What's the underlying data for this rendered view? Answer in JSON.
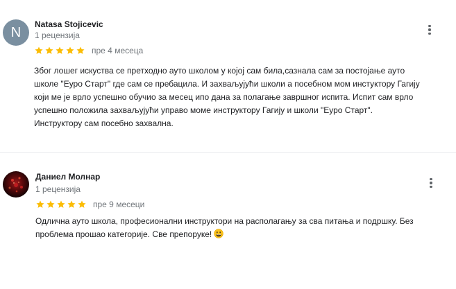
{
  "reviews": [
    {
      "avatar_letter": "N",
      "author": "Natasa Stojicevic",
      "review_count": "1 рецензија",
      "rating": 5,
      "time_ago": "пре 4 месеца",
      "text_lines": [
        "Због лошег искуства се претходно ауто школом у којој сам била,сазнала сам за постојање  ауто",
        "школе \"Еуро Старт\" где сам се пребацила. И захваљујући школи а посебном мом инстуктору Гагију",
        "који ме је врло успешно обучио за месец ипо дана за полагање завршног испита. Испит  сам врло",
        "успешно положила захваљујући управо моме инструктору Гагију и школи \"Еуро Старт\".",
        "Инструктору сам посебно захвална."
      ]
    },
    {
      "author": "Даниел Молнар",
      "review_count": "1 рецензија",
      "rating": 5,
      "time_ago": "пре 9 месеци",
      "text_lines": [
        "Одлична ауто школа, професионални инструктори на располагању за сва питања и подршку. Без",
        "проблема прошао категорије. Све препоруке!"
      ],
      "emoji": "grinning-face-emoji"
    }
  ],
  "colors": {
    "star": "#fbbc04",
    "secondary_text": "#70757a",
    "avatar_letter_bg": "#7a8fa0"
  }
}
